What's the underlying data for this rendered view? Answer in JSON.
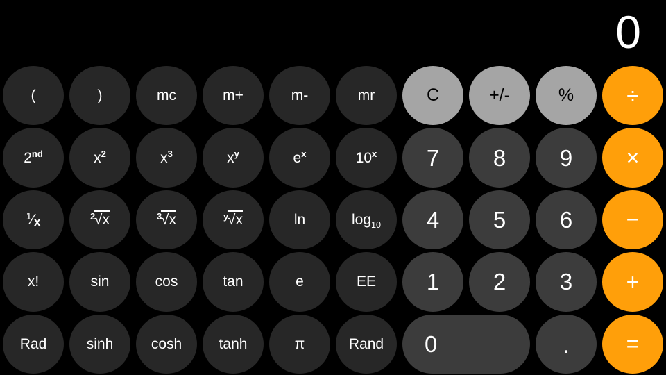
{
  "app": {
    "name": "Calculator",
    "mode": "scientific-landscape"
  },
  "display": {
    "value": "0"
  },
  "colors": {
    "background": "#000000",
    "function_key": "#272727",
    "number_key": "#3c3c3c",
    "top_key": "#a5a5a5",
    "operator_key": "#ff9f0a",
    "text": "#ffffff",
    "top_key_text": "#000000"
  },
  "keypad": {
    "columns": 10,
    "rows": 5,
    "keys": [
      {
        "id": "open-paren",
        "label": "(",
        "kind": "func",
        "row": 1,
        "col": 1,
        "icon": "open-parenthesis"
      },
      {
        "id": "close-paren",
        "label": ")",
        "kind": "func",
        "row": 1,
        "col": 2,
        "icon": "close-parenthesis"
      },
      {
        "id": "mc",
        "label": "mc",
        "kind": "func",
        "row": 1,
        "col": 3
      },
      {
        "id": "m-plus",
        "label": "m+",
        "kind": "func",
        "row": 1,
        "col": 4
      },
      {
        "id": "m-minus",
        "label": "m-",
        "kind": "func",
        "row": 1,
        "col": 5
      },
      {
        "id": "mr",
        "label": "mr",
        "kind": "func",
        "row": 1,
        "col": 6
      },
      {
        "id": "clear",
        "label": "C",
        "kind": "top",
        "row": 1,
        "col": 7
      },
      {
        "id": "sign",
        "label": "+/-",
        "kind": "top",
        "row": 1,
        "col": 8,
        "icon": "plus-minus-icon"
      },
      {
        "id": "percent",
        "label": "%",
        "kind": "top",
        "row": 1,
        "col": 9
      },
      {
        "id": "divide",
        "label": "÷",
        "kind": "op",
        "row": 1,
        "col": 10,
        "icon": "divide-icon"
      },
      {
        "id": "second",
        "label": "2nd",
        "kind": "func",
        "row": 2,
        "col": 1,
        "base": "2",
        "sup": "nd"
      },
      {
        "id": "x-squared",
        "label": "x2",
        "kind": "func",
        "row": 2,
        "col": 2,
        "base": "x",
        "sup": "2"
      },
      {
        "id": "x-cubed",
        "label": "x3",
        "kind": "func",
        "row": 2,
        "col": 3,
        "base": "x",
        "sup": "3"
      },
      {
        "id": "x-pow-y",
        "label": "xy",
        "kind": "func",
        "row": 2,
        "col": 4,
        "base": "x",
        "sup": "y"
      },
      {
        "id": "e-pow-x",
        "label": "ex",
        "kind": "func",
        "row": 2,
        "col": 5,
        "base": "e",
        "sup": "x"
      },
      {
        "id": "ten-pow-x",
        "label": "10x",
        "kind": "func",
        "row": 2,
        "col": 6,
        "base": "10",
        "sup": "x"
      },
      {
        "id": "seven",
        "label": "7",
        "kind": "num",
        "row": 2,
        "col": 7
      },
      {
        "id": "eight",
        "label": "8",
        "kind": "num",
        "row": 2,
        "col": 8
      },
      {
        "id": "nine",
        "label": "9",
        "kind": "num",
        "row": 2,
        "col": 9
      },
      {
        "id": "multiply",
        "label": "×",
        "kind": "op",
        "row": 2,
        "col": 10,
        "icon": "multiply-icon"
      },
      {
        "id": "reciprocal",
        "label": "1/x",
        "kind": "func",
        "row": 3,
        "col": 1,
        "fraction": {
          "numerator": "1",
          "denominator": "x"
        }
      },
      {
        "id": "sqrt",
        "label": "2√x",
        "kind": "func",
        "row": 3,
        "col": 2,
        "radical": {
          "index": "2",
          "body": "x"
        }
      },
      {
        "id": "cbrt",
        "label": "3√x",
        "kind": "func",
        "row": 3,
        "col": 3,
        "radical": {
          "index": "3",
          "body": "x"
        }
      },
      {
        "id": "yroot",
        "label": "y√x",
        "kind": "func",
        "row": 3,
        "col": 4,
        "radical": {
          "index": "y",
          "body": "x"
        }
      },
      {
        "id": "ln",
        "label": "ln",
        "kind": "func",
        "row": 3,
        "col": 5
      },
      {
        "id": "log10",
        "label": "log10",
        "kind": "func",
        "row": 3,
        "col": 6,
        "base": "log",
        "subscript": "10"
      },
      {
        "id": "four",
        "label": "4",
        "kind": "num",
        "row": 3,
        "col": 7
      },
      {
        "id": "five",
        "label": "5",
        "kind": "num",
        "row": 3,
        "col": 8
      },
      {
        "id": "six",
        "label": "6",
        "kind": "num",
        "row": 3,
        "col": 9
      },
      {
        "id": "minus",
        "label": "−",
        "kind": "op",
        "row": 3,
        "col": 10,
        "icon": "minus-icon"
      },
      {
        "id": "factorial",
        "label": "x!",
        "kind": "func",
        "row": 4,
        "col": 1
      },
      {
        "id": "sin",
        "label": "sin",
        "kind": "func",
        "row": 4,
        "col": 2
      },
      {
        "id": "cos",
        "label": "cos",
        "kind": "func",
        "row": 4,
        "col": 3
      },
      {
        "id": "tan",
        "label": "tan",
        "kind": "func",
        "row": 4,
        "col": 4
      },
      {
        "id": "euler",
        "label": "e",
        "kind": "func",
        "row": 4,
        "col": 5
      },
      {
        "id": "ee",
        "label": "EE",
        "kind": "func",
        "row": 4,
        "col": 6
      },
      {
        "id": "one",
        "label": "1",
        "kind": "num",
        "row": 4,
        "col": 7
      },
      {
        "id": "two",
        "label": "2",
        "kind": "num",
        "row": 4,
        "col": 8
      },
      {
        "id": "three",
        "label": "3",
        "kind": "num",
        "row": 4,
        "col": 9
      },
      {
        "id": "plus",
        "label": "+",
        "kind": "op",
        "row": 4,
        "col": 10,
        "icon": "plus-icon"
      },
      {
        "id": "rad",
        "label": "Rad",
        "kind": "func",
        "row": 5,
        "col": 1
      },
      {
        "id": "sinh",
        "label": "sinh",
        "kind": "func",
        "row": 5,
        "col": 2
      },
      {
        "id": "cosh",
        "label": "cosh",
        "kind": "func",
        "row": 5,
        "col": 3
      },
      {
        "id": "tanh",
        "label": "tanh",
        "kind": "func",
        "row": 5,
        "col": 4
      },
      {
        "id": "pi",
        "label": "π",
        "kind": "func",
        "row": 5,
        "col": 5
      },
      {
        "id": "rand",
        "label": "Rand",
        "kind": "func",
        "row": 5,
        "col": 6
      },
      {
        "id": "zero",
        "label": "0",
        "kind": "zero",
        "row": 5,
        "col": 7,
        "span": 2
      },
      {
        "id": "decimal",
        "label": ".",
        "kind": "dot",
        "row": 5,
        "col": 9,
        "icon": "decimal-point"
      },
      {
        "id": "equals",
        "label": "=",
        "kind": "op",
        "row": 5,
        "col": 10,
        "icon": "equals-icon"
      }
    ]
  }
}
